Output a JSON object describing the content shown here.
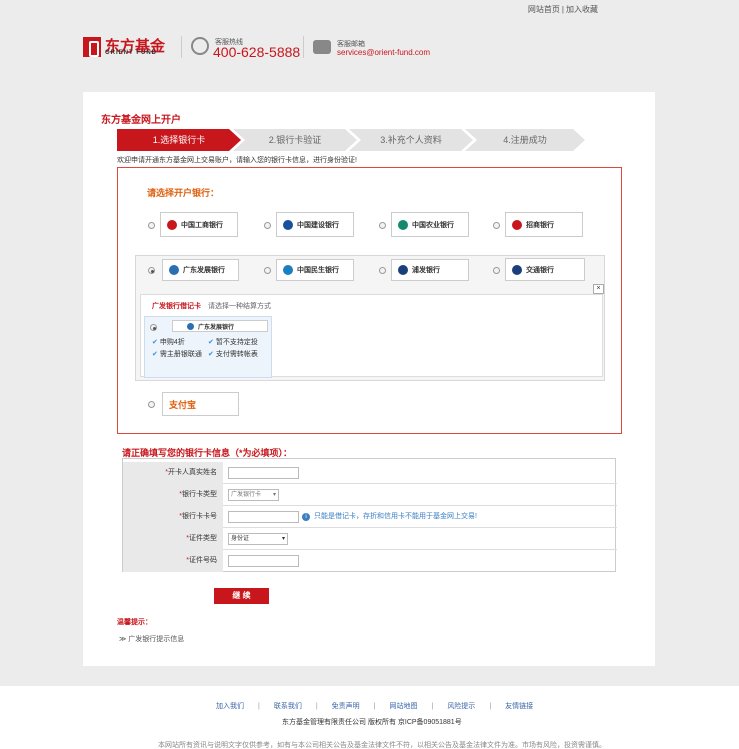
{
  "header": {
    "top_links": [
      "网站首页",
      "加入收藏"
    ],
    "top_sep": "|",
    "logo_cn": "东方基金",
    "logo_en": "ORIENT FUND",
    "hotline_label": "客服热线",
    "hotline_number": "400-628-5888",
    "email_label": "客服邮箱",
    "email_address": "services@orient-fund.com"
  },
  "page": {
    "title": "东方基金网上开户",
    "steps": [
      "1.选择银行卡",
      "2.银行卡验证",
      "3.补充个人资料",
      "4.注册成功"
    ],
    "active_step": 0,
    "intro": "欢迎申请开通东方基金网上交易账户，请输入您的银行卡信息，进行身份验证!"
  },
  "bank_select": {
    "heading": "请选择开户银行：",
    "banks": [
      {
        "name": "中国工商银行",
        "color": "#c8161d"
      },
      {
        "name": "中国建设银行",
        "color": "#1a4f9c"
      },
      {
        "name": "中国农业银行",
        "color": "#138a6d"
      },
      {
        "name": "招商银行",
        "color": "#c8161d"
      },
      {
        "name": "广东发展银行",
        "color": "#2a6fb3"
      },
      {
        "name": "中国民生银行",
        "color": "#1a7fc0"
      },
      {
        "name": "浦发银行",
        "color": "#1a3f7a"
      },
      {
        "name": "交通银行",
        "color": "#1a3f7a"
      }
    ],
    "selected_bank": 4,
    "card_title": "广发银行借记卡",
    "card_subtitle": "请选择一种结算方式",
    "close_label": "×",
    "card_option_name": "广东发展银行",
    "card_features": [
      "申购4折",
      "暂不支持定投",
      "需主册银联通",
      "支付需转帐表"
    ],
    "extra_option": "支付宝"
  },
  "form": {
    "heading": "请正确填写您的银行卡信息（*为必填项）：",
    "required_mark": "*",
    "fields": [
      {
        "label": "开卡人真实姓名",
        "value": ""
      },
      {
        "label": "银行卡类型",
        "value": "广发银行卡"
      },
      {
        "label": "银行卡卡号",
        "value": "",
        "hint": "只能是借记卡，存折和信用卡不能用于基金网上交易!"
      },
      {
        "label": "证件类型",
        "value": "身份证"
      },
      {
        "label": "证件号码",
        "value": ""
      }
    ],
    "submit_label": "继 续"
  },
  "tips": {
    "heading": "温馨提示：",
    "link": "广发银行提示信息",
    "link_prefix": "≫"
  },
  "footer": {
    "links": [
      "加入我们",
      "联系我们",
      "免责声明",
      "网站地图",
      "风险提示",
      "友情链接"
    ],
    "link_sep": "|",
    "copyright": "东方基金管理有限责任公司  版权所有  京ICP备09051881号",
    "note": "本网站所有资讯与说明文字仅供参考，如有与本公司相关公告及基金法律文件不符，以相关公告及基金法律文件为准。市场有风险，投资需谨慎。"
  }
}
